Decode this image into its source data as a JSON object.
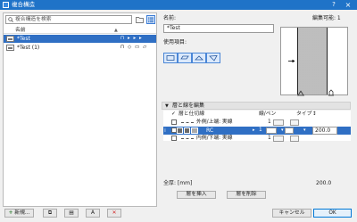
{
  "window": {
    "title": "複合構造",
    "help": "?",
    "close": "×"
  },
  "left_panel": {
    "search_placeholder": "複合構造を検索",
    "column_name": "名前",
    "column_sort": "▲",
    "rows": [
      {
        "label": "*Test",
        "selected": true,
        "icons": "⊓ ▸ ▸ ▸"
      },
      {
        "label": "*Test (1)",
        "selected": false,
        "icons": "⊓ ◇ ▭ ▱"
      }
    ]
  },
  "bottom_left_buttons": {
    "new_plus": "+",
    "new_label": " 新規...",
    "duplicate": "⧉",
    "copy": "▤",
    "rename": "A",
    "delete": "✕"
  },
  "properties": {
    "name_label": "名前:",
    "editable_label": "編集可能: 1",
    "name_value": "*Test",
    "usage_label": "使用項目:"
  },
  "layers_section": {
    "title": "層と線を編集",
    "toggle": "▼",
    "header_check": "✓",
    "header_layer": "層と仕切線",
    "header_pen": "線/ペン",
    "header_type": "タイプ",
    "header_thickness": "↕",
    "rows": [
      {
        "text": "外側/上端: 実線",
        "pen": "1"
      },
      {
        "drag": "⁞",
        "text": "RC",
        "arrow": "▸",
        "pen": "1",
        "pen_dd": "▾",
        "type_dd": "▾",
        "thickness": "200.0"
      },
      {
        "text": "内側/下端: 実線",
        "pen": "1"
      }
    ]
  },
  "totals": {
    "label": "全厚: [mm]",
    "value": "200.0"
  },
  "layer_buttons": {
    "insert": "層を挿入",
    "remove": "層を削除"
  },
  "dialog_buttons": {
    "cancel": "キャンセル",
    "ok": "OK"
  },
  "colors": {
    "title_bar": "#1f73c8",
    "selection": "#2f6fc4",
    "delete_icon": "#d32020",
    "new_icon": "#2f7d32"
  }
}
